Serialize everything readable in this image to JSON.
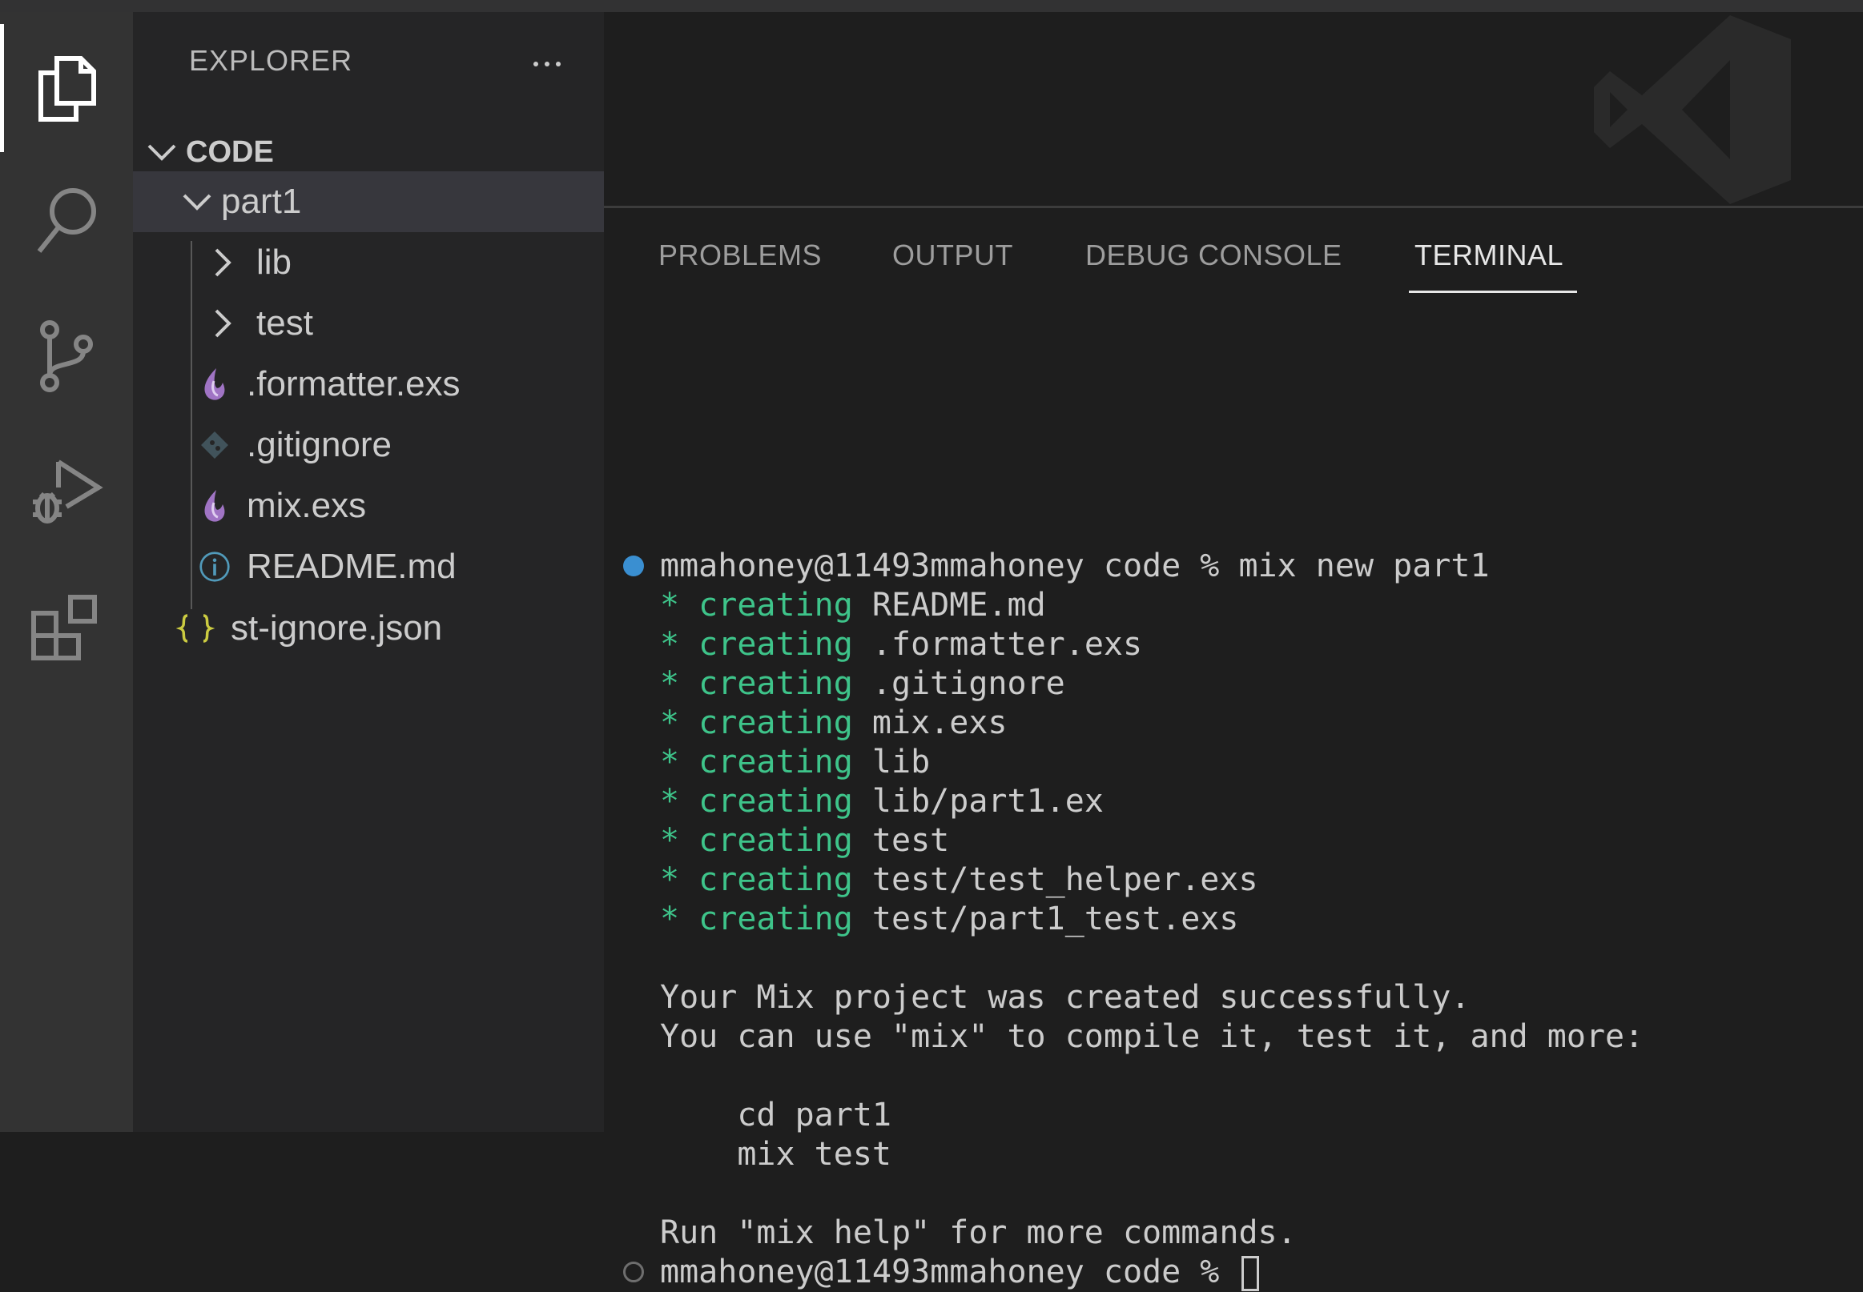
{
  "activity_bar": {
    "items": [
      {
        "icon": "files-icon",
        "active": true
      },
      {
        "icon": "search-icon",
        "active": false
      },
      {
        "icon": "source-control-icon",
        "active": false
      },
      {
        "icon": "run-debug-icon",
        "active": false
      },
      {
        "icon": "extensions-icon",
        "active": false
      }
    ]
  },
  "sidebar": {
    "title": "EXPLORER",
    "section": "CODE",
    "tree": [
      {
        "label": "part1",
        "type": "folder",
        "expanded": true
      },
      {
        "label": "lib",
        "type": "folder",
        "expanded": false
      },
      {
        "label": "test",
        "type": "folder",
        "expanded": false
      },
      {
        "label": ".formatter.exs",
        "type": "file",
        "icon": "elixir-icon"
      },
      {
        "label": ".gitignore",
        "type": "file",
        "icon": "git-icon"
      },
      {
        "label": "mix.exs",
        "type": "file",
        "icon": "elixir-icon"
      },
      {
        "label": "README.md",
        "type": "file",
        "icon": "info-icon"
      },
      {
        "label": "st-ignore.json",
        "type": "file",
        "icon": "json-icon"
      }
    ]
  },
  "panel": {
    "tabs": [
      {
        "label": "PROBLEMS",
        "active": false
      },
      {
        "label": "OUTPUT",
        "active": false
      },
      {
        "label": "DEBUG CONSOLE",
        "active": false
      },
      {
        "label": "TERMINAL",
        "active": true
      }
    ]
  },
  "terminal": {
    "prompt_line": "mmahoney@11493mmahoney code % mix new part1",
    "created": [
      {
        "star": "* ",
        "verb": "creating",
        "path": " README.md"
      },
      {
        "star": "* ",
        "verb": "creating",
        "path": " .formatter.exs"
      },
      {
        "star": "* ",
        "verb": "creating",
        "path": " .gitignore"
      },
      {
        "star": "* ",
        "verb": "creating",
        "path": " mix.exs"
      },
      {
        "star": "* ",
        "verb": "creating",
        "path": " lib"
      },
      {
        "star": "* ",
        "verb": "creating",
        "path": " lib/part1.ex"
      },
      {
        "star": "* ",
        "verb": "creating",
        "path": " test"
      },
      {
        "star": "* ",
        "verb": "creating",
        "path": " test/test_helper.exs"
      },
      {
        "star": "* ",
        "verb": "creating",
        "path": " test/part1_test.exs"
      }
    ],
    "success_line": "Your Mix project was created successfully.",
    "hint_line": "You can use \"mix\" to compile it, test it, and more:",
    "cmd1": "    cd part1",
    "cmd2": "    mix test",
    "help_line": "Run \"mix help\" for more commands.",
    "final_prompt": "mmahoney@11493mmahoney code % "
  },
  "colors": {
    "accent_green": "#3ec48a",
    "dot_blue": "#3a8fd1",
    "elixir_purple": "#a074c4",
    "json_yellow": "#cbcb41",
    "info_blue": "#519aba"
  }
}
